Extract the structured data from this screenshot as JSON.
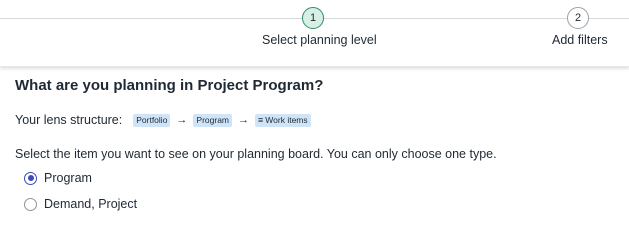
{
  "stepper": {
    "steps": [
      {
        "number": "1",
        "label": "Select planning level",
        "state": "active"
      },
      {
        "number": "2",
        "label": "Add filters",
        "state": "inactive"
      }
    ]
  },
  "main": {
    "heading": "What are you planning in Project Program?",
    "lens": {
      "label": "Your lens structure:",
      "items": [
        "Portfolio",
        "Program",
        "Work items"
      ],
      "separator": "→"
    },
    "instruction": "Select the item you want to see on your planning board. You can only choose one type.",
    "options": [
      {
        "label": "Program",
        "selected": true
      },
      {
        "label": "Demand, Project",
        "selected": false
      }
    ]
  },
  "colors": {
    "active_step_fill": "#d7efe5",
    "active_step_border": "#2f8c6a",
    "chip_background": "#cfe4f7",
    "radio_accent": "#3f4bb5"
  }
}
